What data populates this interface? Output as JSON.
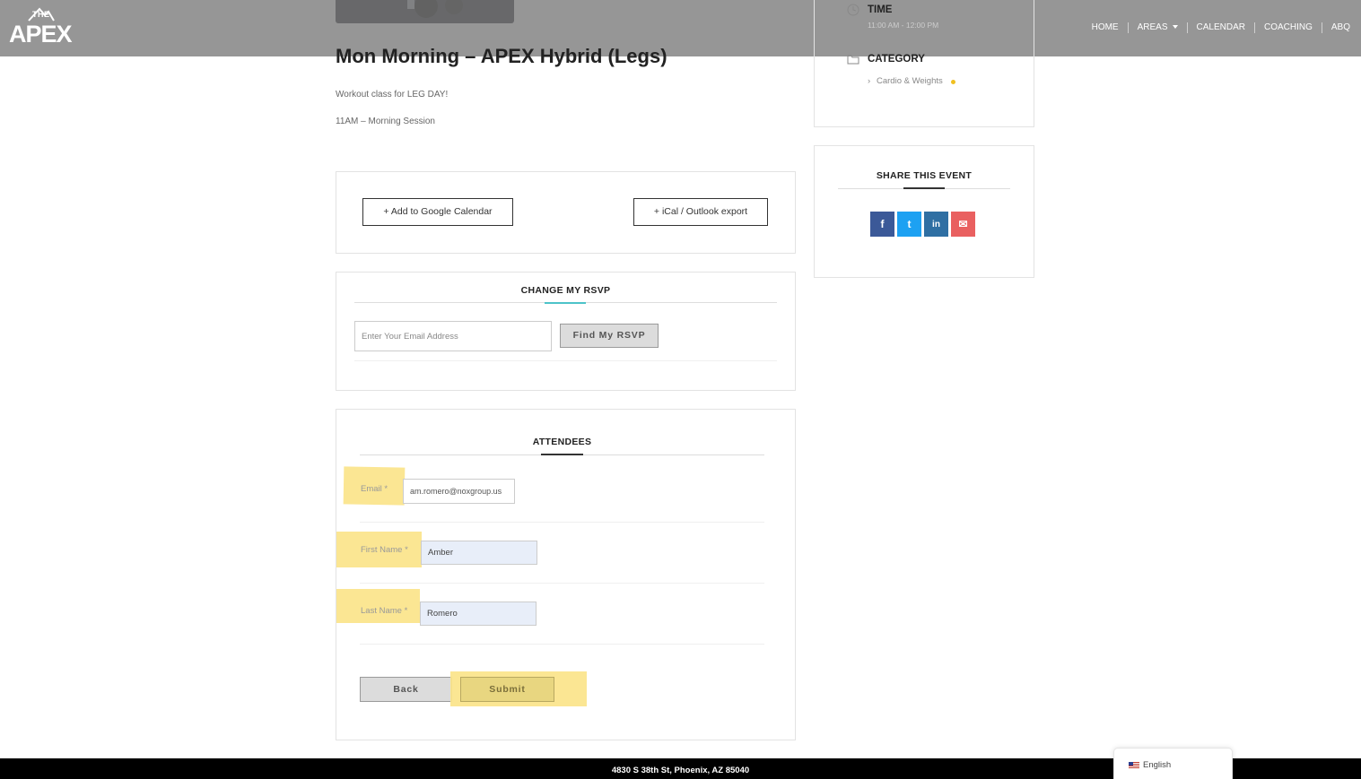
{
  "header": {
    "logo_small": "THE",
    "logo_big": "APEX",
    "nav": [
      {
        "label": "HOME"
      },
      {
        "label": "AREAS"
      },
      {
        "label": "CALENDAR"
      },
      {
        "label": "COACHING"
      },
      {
        "label": "ABQ"
      }
    ]
  },
  "event": {
    "title": "Mon Morning – APEX Hybrid (Legs)",
    "description_lines": [
      "Workout class for LEG DAY!",
      "11AM – Morning Session"
    ]
  },
  "calendar_links": {
    "google": "+ Add to Google Calendar",
    "ical": "+ iCal / Outlook export"
  },
  "rsvp": {
    "title": "CHANGE MY RSVP",
    "email_placeholder": "Enter Your Email Address",
    "find_button": "Find My RSVP"
  },
  "attendees": {
    "title": "ATTENDEES",
    "email_label": "Email *",
    "email_value": "am.romero@noxgroup.us",
    "first_name_label": "First Name *",
    "first_name_value": "Amber",
    "last_name_label": "Last Name *",
    "last_name_value": "Romero",
    "back_button": "Back",
    "submit_button": "Submit"
  },
  "sidebar": {
    "time_label": "TIME",
    "time_value": "11:00 AM - 12:00 PM",
    "category_label": "CATEGORY",
    "category_value": "Cardio & Weights",
    "share_title": "SHARE THIS EVENT",
    "share_buttons": [
      {
        "icon": "facebook-icon",
        "glyph": "f",
        "color": "#3b5998"
      },
      {
        "icon": "twitter-icon",
        "glyph": "t",
        "color": "#1da1f2"
      },
      {
        "icon": "linkedin-icon",
        "glyph": "in",
        "color": "#2f6fa3"
      },
      {
        "icon": "email-icon",
        "glyph": "✉",
        "color": "#e96060"
      }
    ]
  },
  "footer": {
    "address": "4830 S 38th St, Phoenix, AZ 85040",
    "language": "English"
  },
  "colors": {
    "accent": "#4cc3c9",
    "highlight": "#fbe48a",
    "category_dot": "#f0c020"
  }
}
